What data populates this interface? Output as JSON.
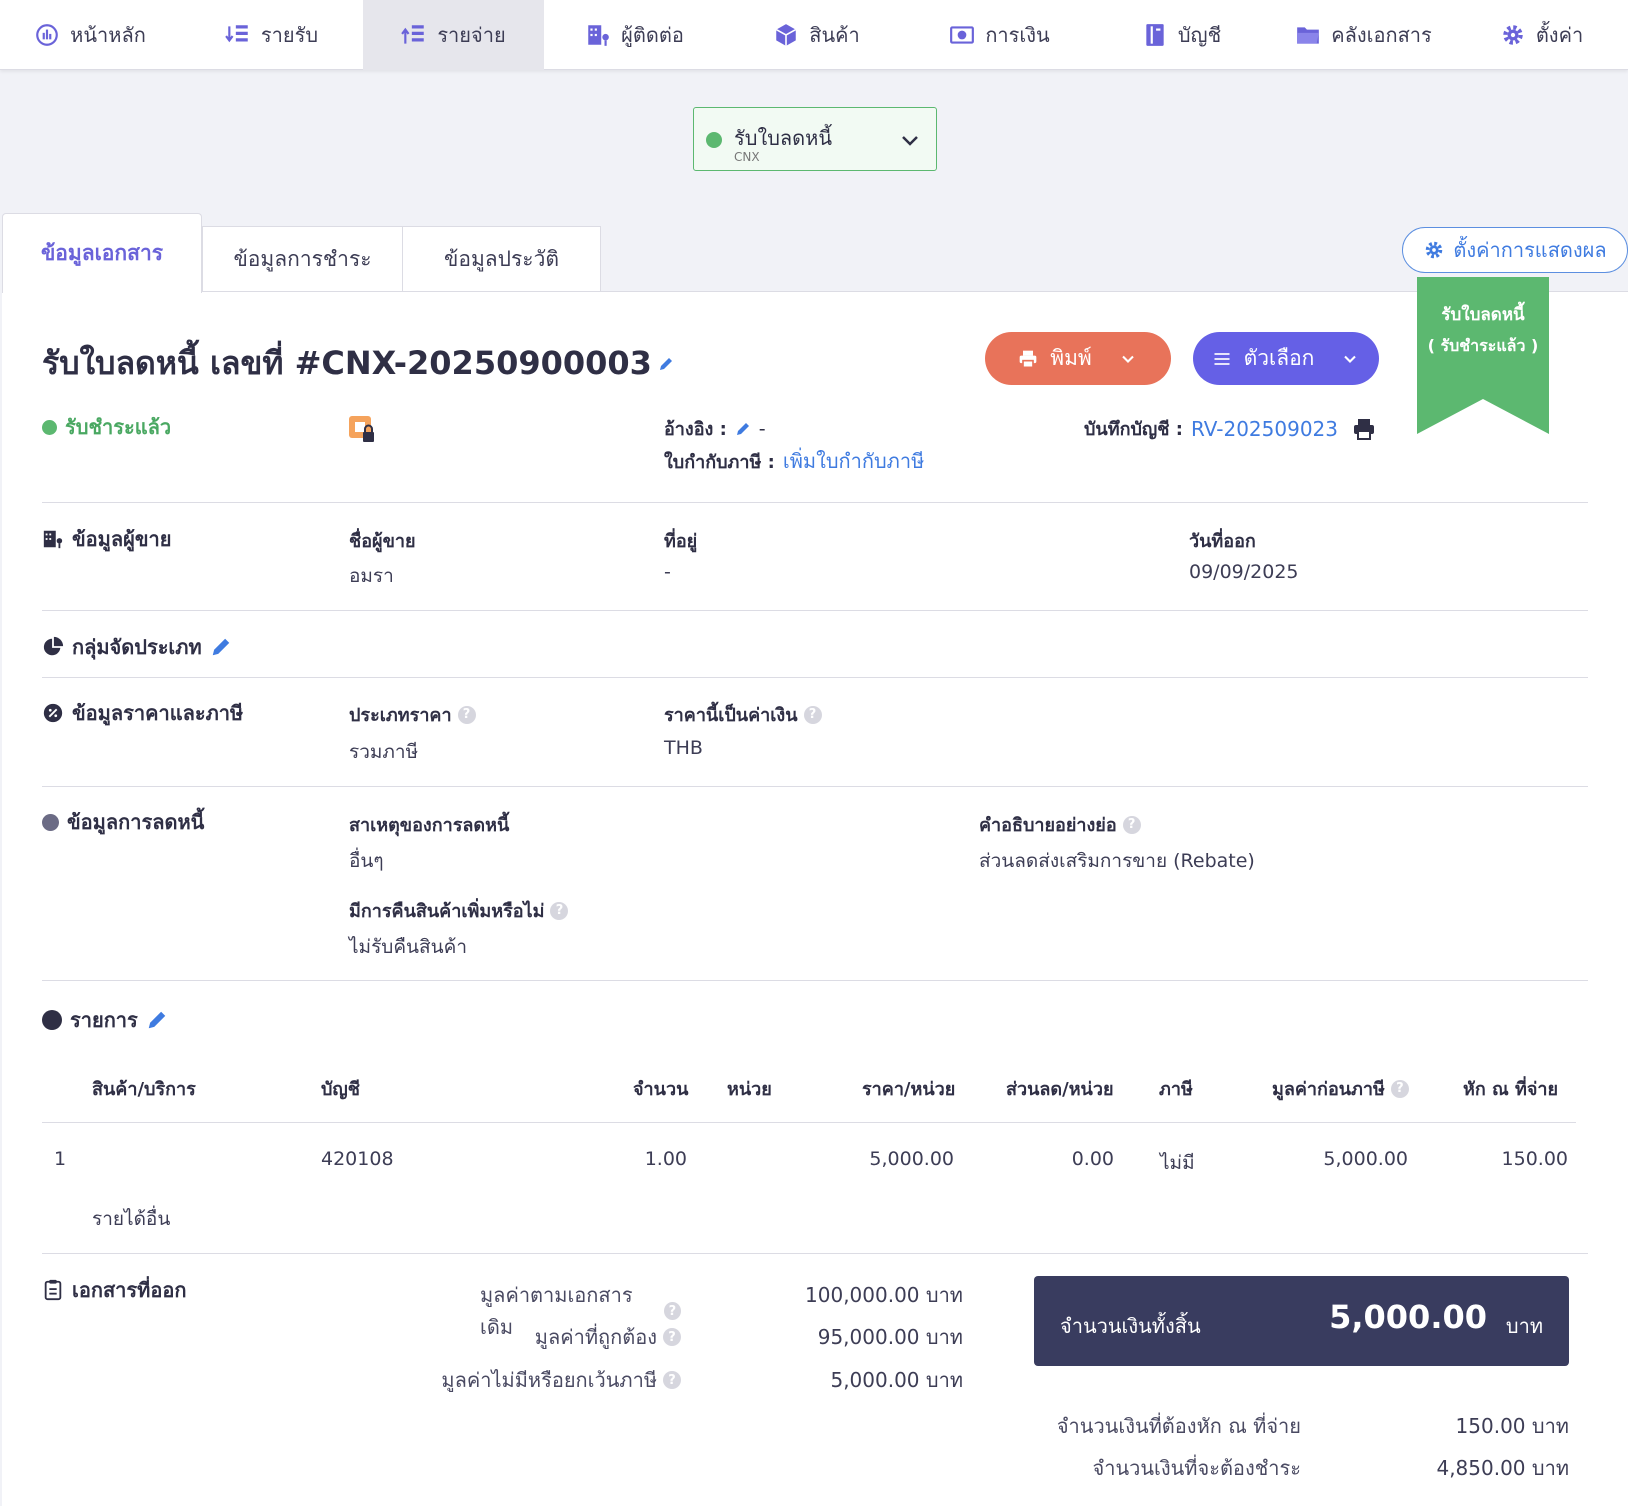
{
  "nav": [
    {
      "label": "หน้าหลัก",
      "icon": "dashboard-icon"
    },
    {
      "label": "รายรับ",
      "icon": "income-list-icon"
    },
    {
      "label": "รายจ่าย",
      "icon": "expense-list-icon"
    },
    {
      "label": "ผู้ติดต่อ",
      "icon": "contacts-building-icon"
    },
    {
      "label": "สินค้า",
      "icon": "box-icon"
    },
    {
      "label": "การเงิน",
      "icon": "money-icon"
    },
    {
      "label": "บัญชี",
      "icon": "ledger-book-icon"
    },
    {
      "label": "คลังเอกสาร",
      "icon": "folder-icon"
    },
    {
      "label": "ตั้งค่า",
      "icon": "gear-icon"
    }
  ],
  "status": {
    "label": "รับใบลดหนี้",
    "code": "CNX"
  },
  "tabs": [
    "ข้อมูลเอกสาร",
    "ข้อมูลการชำระ",
    "ข้อมูลประวัติ"
  ],
  "display_settings": "ตั้งค่าการแสดงผล",
  "ribbon": {
    "line1": "รับใบลดหนี้",
    "line2": "( รับชำระแล้ว )"
  },
  "doc": {
    "title": "รับใบลดหนี้ เลขที่ #CNX-20250900003",
    "print_label": "พิมพ์",
    "options_label": "ตัวเลือก",
    "paid_status": "รับชำระแล้ว",
    "ref_label": "อ้างอิง :",
    "ref_value": "-",
    "tax_label": "ใบกำกับภาษี :",
    "tax_link": "เพิ่มใบกำกับภาษี",
    "journal_label": "บันทึกบัญชี :",
    "journal_link": "RV-202509023"
  },
  "seller": {
    "section": "ข้อมูลผู้ขาย",
    "name_label": "ชื่อผู้ขาย",
    "name": "อมรา",
    "address_label": "ที่อยู่",
    "address": "-",
    "date_label": "วันที่ออก",
    "date": "09/09/2025"
  },
  "group": {
    "section": "กลุ่มจัดประเภท"
  },
  "pricing": {
    "section": "ข้อมูลราคาและภาษี",
    "price_type_label": "ประเภทราคา",
    "price_type": "รวมภาษี",
    "currency_label": "ราคานี้เป็นค่าเงิน",
    "currency": "THB"
  },
  "credit": {
    "section": "ข้อมูลการลดหนี้",
    "reason_label": "สาเหตุของการลดหนี้",
    "reason": "อื่นๆ",
    "desc_label": "คำอธิบายอย่างย่อ",
    "desc": "ส่วนลดส่งเสริมการขาย (Rebate)",
    "return_label": "มีการคืนสินค้าเพิ่มหรือไม่",
    "return": "ไม่รับคืนสินค้า"
  },
  "items": {
    "section": "รายการ",
    "headers": [
      "สินค้า/บริการ",
      "บัญชี",
      "จำนวน",
      "หน่วย",
      "ราคา/หน่วย",
      "ส่วนลด/หน่วย",
      "ภาษี",
      "มูลค่าก่อนภาษี",
      "หัก ณ ที่จ่าย"
    ],
    "rows": [
      {
        "no": "1",
        "account": "420108",
        "qty": "1.00",
        "unit": "",
        "price": "5,000.00",
        "discount": "0.00",
        "tax": "ไม่มี",
        "pre_tax": "5,000.00",
        "wht": "150.00",
        "desc": "รายได้อื่น"
      }
    ]
  },
  "issued": {
    "section": "เอกสารที่ออก",
    "orig_label": "มูลค่าตามเอกสารเดิม",
    "orig_value": "100,000.00 บาท",
    "correct_label": "มูลค่าที่ถูกต้อง",
    "correct_value": "95,000.00 บาท",
    "exempt_label": "มูลค่าไม่มีหรือยกเว้นภาษี",
    "exempt_value": "5,000.00 บาท"
  },
  "totals": {
    "total_label": "จำนวนเงินทั้งสิ้น",
    "total_value": "5,000.00",
    "unit": "บาท",
    "wht_label": "จำนวนเงินที่ต้องหัก ณ ที่จ่าย",
    "wht_value": "150.00 บาท",
    "pay_label": "จำนวนเงินที่จะต้องชำระ",
    "pay_value": "4,850.00 บาท"
  },
  "colors": {
    "accent": "#6a63d9",
    "success": "#5cb870",
    "print": "#e8735a",
    "options": "#6560e6",
    "total_bg": "#393c5f",
    "link": "#3f7be0"
  }
}
